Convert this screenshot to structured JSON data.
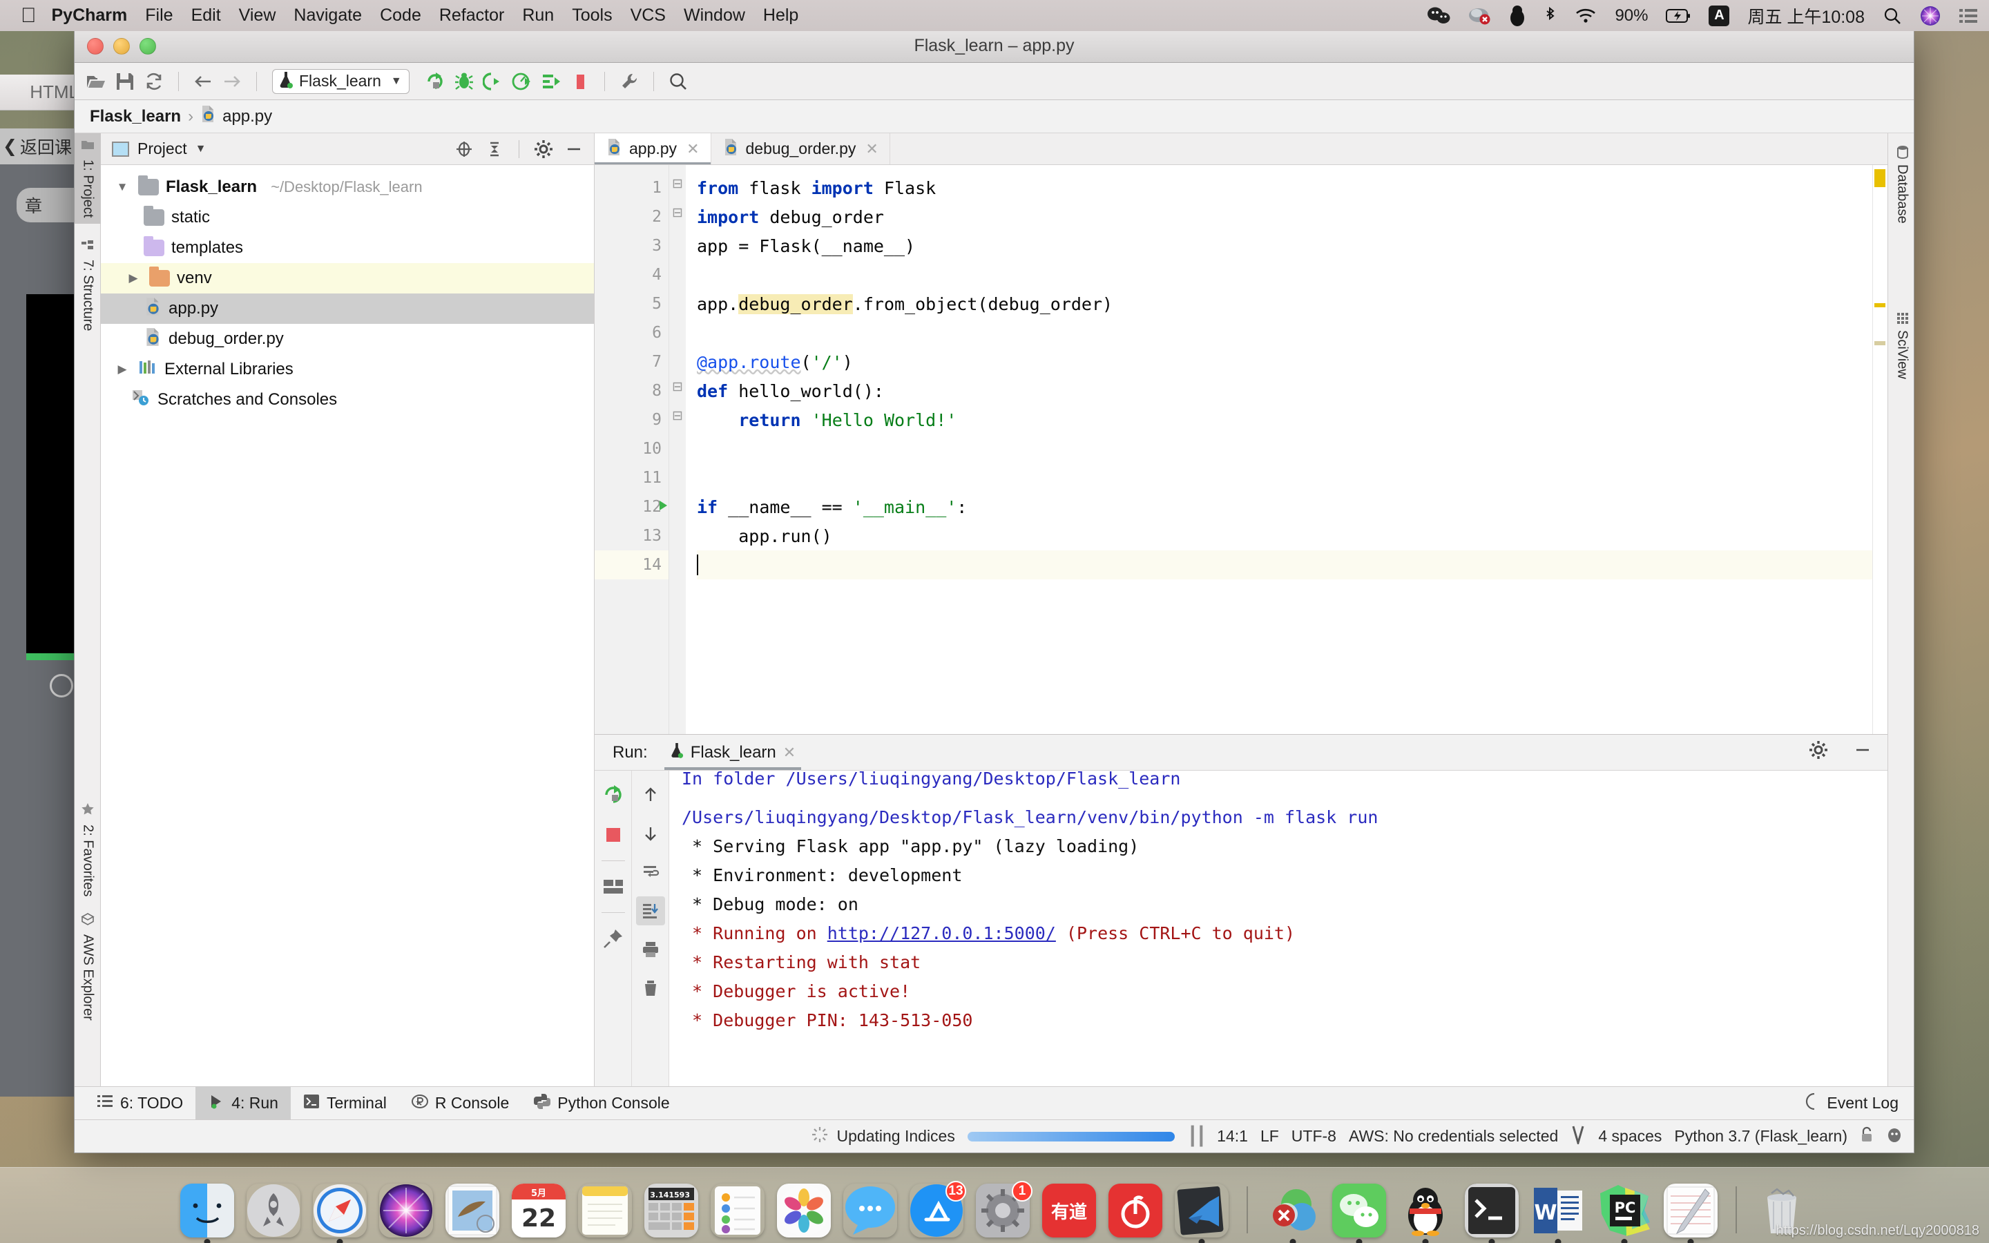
{
  "menubar": {
    "apple_icon": "apple-icon",
    "app_name": "PyCharm",
    "items": [
      "File",
      "Edit",
      "View",
      "Navigate",
      "Code",
      "Refactor",
      "Run",
      "Tools",
      "VCS",
      "Window",
      "Help"
    ],
    "status": {
      "wechat_icon": "wechat-icon",
      "onedrive_icon": "onedrive-error-icon",
      "qq_icon": "qq-penguin-icon",
      "bluetooth_icon": "bluetooth-icon",
      "wifi_icon": "wifi-icon",
      "battery_percent": "90%",
      "battery_icon": "battery-charging-icon",
      "input_source": "A",
      "clock": "周五 上午10:08",
      "spotlight_icon": "search-icon",
      "siri_icon": "siri-icon",
      "controlcenter_icon": "list-icon"
    }
  },
  "background_window": {
    "title": "HTML",
    "back_label": "返回课",
    "chip_label": "章"
  },
  "window": {
    "title": "Flask_learn – app.py"
  },
  "toolbar": {
    "open_icon": "open-folder-icon",
    "save_icon": "save-icon",
    "sync_icon": "sync-icon",
    "back_icon": "arrow-left-icon",
    "forward_icon": "arrow-right-icon",
    "run_config": "Flask_learn",
    "run_config_icon": "flask-icon",
    "run_icon": "run-icon",
    "debug_icon": "debug-bug-icon",
    "coverage_icon": "run-coverage-icon",
    "profile_icon": "profile-icon",
    "rerun_icon": "step-icon",
    "stop_icon": "stop-icon",
    "settings_icon": "wrench-icon",
    "search_icon": "search-icon"
  },
  "breadcrumb": {
    "project": "Flask_learn",
    "separator": "›",
    "file": "app.py",
    "file_icon": "python-file-icon"
  },
  "left_stripe": [
    {
      "label": "1: Project",
      "icon": "project-folder-icon",
      "active": true
    },
    {
      "label": "7: Structure",
      "icon": "structure-icon",
      "active": false
    },
    {
      "label": "2: Favorites",
      "icon": "star-icon",
      "active": false
    },
    {
      "label": "AWS Explorer",
      "icon": "aws-cube-icon",
      "active": false
    }
  ],
  "right_stripe": [
    {
      "label": "Database",
      "icon": "database-icon"
    },
    {
      "label": "SciView",
      "icon": "grid-icon"
    }
  ],
  "project_panel": {
    "title": "Project",
    "title_icon": "project-view-icon",
    "caret_icon": "chevron-down-icon",
    "locate_icon": "crosshair-icon",
    "collapse_icon": "collapse-all-icon",
    "gear_icon": "gear-icon",
    "minimize_icon": "minimize-icon",
    "tree": [
      {
        "label": "Flask_learn",
        "path": "~/Desktop/Flask_learn",
        "icon": "folder-grey-icon",
        "arrow": "▼",
        "depth": 0,
        "bold": true,
        "state": ""
      },
      {
        "label": "static",
        "path": "",
        "icon": "folder-grey-icon",
        "arrow": "",
        "depth": 1,
        "bold": false,
        "state": ""
      },
      {
        "label": "templates",
        "path": "",
        "icon": "folder-purple-icon",
        "arrow": "",
        "depth": 1,
        "bold": false,
        "state": ""
      },
      {
        "label": "venv",
        "path": "",
        "icon": "folder-orange-icon",
        "arrow": "▶",
        "depth": 1,
        "bold": false,
        "state": "hl"
      },
      {
        "label": "app.py",
        "path": "",
        "icon": "python-file-icon",
        "arrow": "",
        "depth": 1,
        "bold": false,
        "state": "sel"
      },
      {
        "label": "debug_order.py",
        "path": "",
        "icon": "python-file-icon",
        "arrow": "",
        "depth": 1,
        "bold": false,
        "state": ""
      },
      {
        "label": "External Libraries",
        "path": "",
        "icon": "libraries-icon",
        "arrow": "▶",
        "depth": 0,
        "bold": false,
        "state": ""
      },
      {
        "label": "Scratches and Consoles",
        "path": "",
        "icon": "scratches-icon",
        "arrow": "",
        "depth": 0,
        "bold": false,
        "state": ""
      }
    ]
  },
  "editor": {
    "tabs": [
      {
        "label": "app.py",
        "icon": "python-file-icon",
        "active": true,
        "close_icon": "close-icon"
      },
      {
        "label": "debug_order.py",
        "icon": "python-file-icon",
        "active": false,
        "close_icon": "close-icon"
      }
    ],
    "lines": [
      {
        "n": "1",
        "fold": "⊟",
        "gutter_icon": "",
        "current": false
      },
      {
        "n": "2",
        "fold": "⊟",
        "gutter_icon": "",
        "current": false
      },
      {
        "n": "3",
        "fold": "",
        "gutter_icon": "",
        "current": false
      },
      {
        "n": "4",
        "fold": "",
        "gutter_icon": "",
        "current": false
      },
      {
        "n": "5",
        "fold": "",
        "gutter_icon": "",
        "current": false
      },
      {
        "n": "6",
        "fold": "",
        "gutter_icon": "",
        "current": false
      },
      {
        "n": "7",
        "fold": "",
        "gutter_icon": "",
        "current": false
      },
      {
        "n": "8",
        "fold": "⊟",
        "gutter_icon": "",
        "current": false
      },
      {
        "n": "9",
        "fold": "⊟",
        "gutter_icon": "",
        "current": false
      },
      {
        "n": "10",
        "fold": "",
        "gutter_icon": "",
        "current": false
      },
      {
        "n": "11",
        "fold": "",
        "gutter_icon": "",
        "current": false
      },
      {
        "n": "12",
        "fold": "",
        "gutter_icon": "run-gutter-icon",
        "current": false
      },
      {
        "n": "13",
        "fold": "",
        "gutter_icon": "",
        "current": false
      },
      {
        "n": "14",
        "fold": "",
        "gutter_icon": "",
        "current": true
      }
    ],
    "code": {
      "l1_kw1": "from",
      "l1_mod": " flask ",
      "l1_kw2": "import",
      "l1_name": " Flask",
      "l2_kw": "import",
      "l2_mod": " debug_order",
      "l3": "app = Flask(__name__)",
      "l5_a": "app.",
      "l5_hl": "debug_order",
      "l5_b": ".from_object(debug_order)",
      "l7_deco": "@app.route",
      "l7_p1": "(",
      "l7_str": "'/'",
      "l7_p2": ")",
      "l8_kw": "def",
      "l8_rest": " hello_world():",
      "l9_kw": "return",
      "l9_str": "'Hello World!'",
      "l12_kw": "if",
      "l12_mid": " __name__ == ",
      "l12_str": "'__main__'",
      "l12_end": ":",
      "l13": "app.run()"
    }
  },
  "run_window": {
    "label": "Run:",
    "tab_label": "Flask_learn",
    "tab_icon": "flask-icon",
    "close_icon": "close-icon",
    "gear_icon": "gear-icon",
    "minimize_icon": "minimize-icon",
    "side_buttons": [
      {
        "icon": "rerun-icon",
        "name": "rerun-button",
        "active": false
      },
      {
        "icon": "stop-icon",
        "name": "stop-button",
        "active": false
      },
      {
        "icon": "layout-icon",
        "name": "layout-button",
        "active": false
      },
      {
        "icon": "pin-icon",
        "name": "pin-button",
        "active": false
      }
    ],
    "side_buttons2": [
      {
        "icon": "arrow-up-icon",
        "name": "scroll-up-button",
        "active": false
      },
      {
        "icon": "arrow-down-icon",
        "name": "scroll-down-button",
        "active": false
      },
      {
        "icon": "soft-wrap-icon",
        "name": "soft-wrap-button",
        "active": false
      },
      {
        "icon": "scroll-to-end-icon",
        "name": "scroll-to-end-button",
        "active": true
      },
      {
        "icon": "print-icon",
        "name": "print-button",
        "active": false
      },
      {
        "icon": "trash-icon",
        "name": "clear-all-button",
        "active": false
      }
    ],
    "output": [
      {
        "type": "blue",
        "text": "In folder /Users/liuqingyang/Desktop/Flask_learn",
        "clipped": true
      },
      {
        "type": "blue",
        "text": "/Users/liuqingyang/Desktop/Flask_learn/venv/bin/python -m flask run"
      },
      {
        "type": "black",
        "text": " * Serving Flask app \"app.py\" (lazy loading)"
      },
      {
        "type": "black",
        "text": " * Environment: development"
      },
      {
        "type": "black",
        "text": " * Debug mode: on"
      },
      {
        "type": "red_link",
        "pre": " * Running on ",
        "link": "http://127.0.0.1:5000/",
        "post": " (Press CTRL+C to quit)"
      },
      {
        "type": "red",
        "text": " * Restarting with stat"
      },
      {
        "type": "red",
        "text": " * Debugger is active!"
      },
      {
        "type": "red",
        "text": " * Debugger PIN: 143-513-050"
      }
    ]
  },
  "bottom_tabs": [
    {
      "label": "6: TODO",
      "icon": "todo-list-icon",
      "active": false
    },
    {
      "label": "4: Run",
      "icon": "run-icon",
      "active": true
    },
    {
      "label": "Terminal",
      "icon": "terminal-icon",
      "active": false
    },
    {
      "label": "R Console",
      "icon": "r-console-icon",
      "active": false
    },
    {
      "label": "Python Console",
      "icon": "python-console-icon",
      "active": false
    }
  ],
  "event_log": {
    "label": "Event Log",
    "icon": "event-log-icon"
  },
  "statusbar": {
    "indexing_icon": "spinner-icon",
    "indexing_text": "Updating Indices",
    "pause_icon": "pause-icon",
    "caret_position": "14:1",
    "line_separator": "LF",
    "encoding": "UTF-8",
    "aws": "AWS: No credentials selected",
    "branch_icon": "vcs-branch-icon",
    "indent": "4 spaces",
    "interpreter": "Python 3.7 (Flask_learn)",
    "lock_icon": "lock-icon",
    "hector_icon": "hector-icon"
  },
  "dock": {
    "items": [
      {
        "name": "finder",
        "label": "Finder",
        "running": true,
        "badge": ""
      },
      {
        "name": "launchpad",
        "label": "Launchpad",
        "running": false,
        "badge": ""
      },
      {
        "name": "safari",
        "label": "Safari",
        "running": true,
        "badge": ""
      },
      {
        "name": "siri",
        "label": "Siri",
        "running": false,
        "badge": ""
      },
      {
        "name": "mail",
        "label": "Mail",
        "running": false,
        "badge": ""
      },
      {
        "name": "calendar",
        "label": "Calendar",
        "running": false,
        "badge": "",
        "day": "22",
        "month": "5月"
      },
      {
        "name": "notes",
        "label": "Notes",
        "running": false,
        "badge": ""
      },
      {
        "name": "calculator",
        "label": "Calculator",
        "running": false,
        "badge": "",
        "display": "3.141593"
      },
      {
        "name": "reminders",
        "label": "Reminders",
        "running": false,
        "badge": ""
      },
      {
        "name": "photos",
        "label": "Photos",
        "running": false,
        "badge": ""
      },
      {
        "name": "messages",
        "label": "Messages",
        "running": false,
        "badge": ""
      },
      {
        "name": "app-store",
        "label": "App Store",
        "running": false,
        "badge": "13"
      },
      {
        "name": "system-prefs",
        "label": "System Preferences",
        "running": false,
        "badge": "1"
      },
      {
        "name": "youdao",
        "label": "有道",
        "running": false,
        "badge": ""
      },
      {
        "name": "netease-music",
        "label": "网易云音乐",
        "running": false,
        "badge": ""
      },
      {
        "name": "vscode",
        "label": "Visual Studio Code",
        "running": true,
        "badge": ""
      },
      {
        "name": "sep1",
        "label": "",
        "running": false,
        "badge": ""
      },
      {
        "name": "xmind",
        "label": "XMind",
        "running": true,
        "badge": ""
      },
      {
        "name": "wechat",
        "label": "WeChat",
        "running": true,
        "badge": ""
      },
      {
        "name": "qq",
        "label": "QQ",
        "running": true,
        "badge": ""
      },
      {
        "name": "terminal",
        "label": "Terminal",
        "running": true,
        "badge": ""
      },
      {
        "name": "word",
        "label": "Microsoft Word",
        "running": true,
        "badge": ""
      },
      {
        "name": "pycharm",
        "label": "PyCharm",
        "running": true,
        "badge": ""
      },
      {
        "name": "textedit",
        "label": "TextEdit",
        "running": true,
        "badge": ""
      },
      {
        "name": "sep2",
        "label": "",
        "running": false,
        "badge": ""
      },
      {
        "name": "trash",
        "label": "Trash",
        "running": false,
        "badge": ""
      }
    ]
  },
  "watermark": "https://blog.csdn.net/Lqy2000818"
}
